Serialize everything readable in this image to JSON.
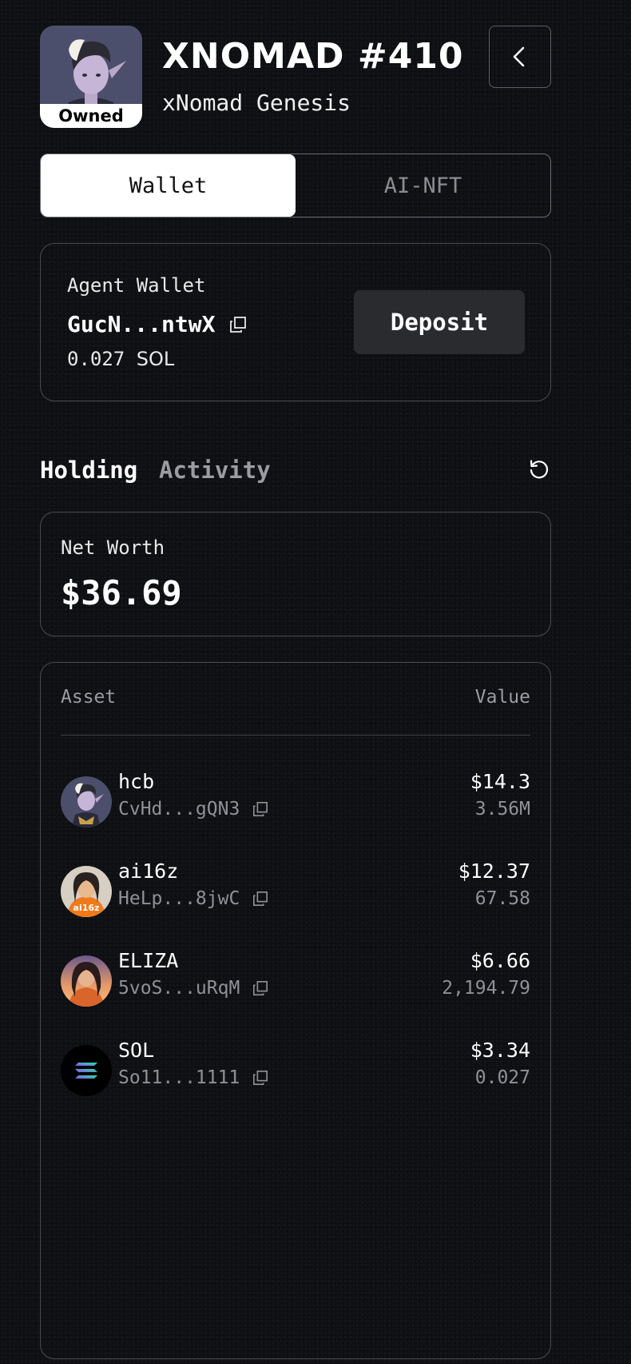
{
  "header": {
    "title": "XNOMAD #410",
    "subtitle": "xNomad Genesis",
    "owned_badge": "Owned"
  },
  "tabs": [
    {
      "label": "Wallet",
      "active": true
    },
    {
      "label": "AI-NFT",
      "active": false
    }
  ],
  "wallet": {
    "label": "Agent Wallet",
    "address": "GucN...ntwX",
    "balance_amount": "0.027",
    "balance_unit": "SOL",
    "deposit_label": "Deposit"
  },
  "sub_tabs": [
    {
      "label": "Holding",
      "active": true
    },
    {
      "label": "Activity",
      "active": false
    }
  ],
  "net_worth": {
    "label": "Net Worth",
    "value": "$36.69"
  },
  "assets": {
    "col_asset": "Asset",
    "col_value": "Value",
    "rows": [
      {
        "name": "hcb",
        "address": "CvHd...gQN3",
        "usd": "$14.3",
        "amount": "3.56M",
        "icon": "hcb-token-icon"
      },
      {
        "name": "ai16z",
        "address": "HeLp...8jwC",
        "usd": "$12.37",
        "amount": "67.58",
        "icon": "ai16z-token-icon"
      },
      {
        "name": "ELIZA",
        "address": "5voS...uRqM",
        "usd": "$6.66",
        "amount": "2,194.79",
        "icon": "eliza-token-icon"
      },
      {
        "name": "SOL",
        "address": "So11...1111",
        "usd": "$3.34",
        "amount": "0.027",
        "icon": "solana-token-icon"
      }
    ]
  },
  "colors": {
    "background": "#0e0f12",
    "card_border": "#4a4c52",
    "muted_text": "#8f9197",
    "deposit_bg": "#2a2b2f"
  }
}
